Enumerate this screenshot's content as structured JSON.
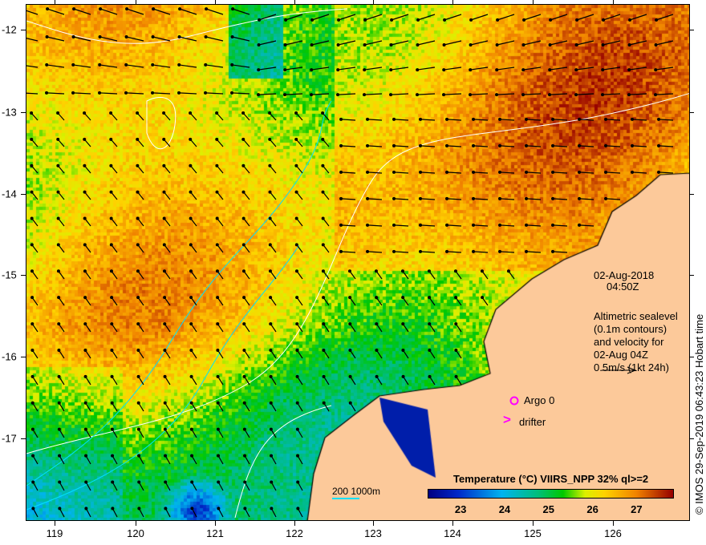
{
  "axes": {
    "lon_ticks": [
      "119",
      "120",
      "121",
      "122",
      "123",
      "124",
      "125",
      "126"
    ],
    "lat_ticks": [
      "-12",
      "-13",
      "-14",
      "-15",
      "-16",
      "-17"
    ]
  },
  "annotation": {
    "date": "02-Aug-2018",
    "time": "04:50Z",
    "sealevel_lines": [
      "Altimetric sealevel",
      "(0.1m contours)",
      "and velocity for",
      "02-Aug 04Z",
      "0.5m/s (1kt 24h)"
    ]
  },
  "legend": {
    "argo": "Argo 0",
    "drifter": "drifter",
    "drifter_symbol": ">",
    "bathy": "200  1000m"
  },
  "colorbar": {
    "title": "Temperature (°C) VIIRS_NPP 32% ql>=2",
    "ticks": [
      "23",
      "24",
      "25",
      "26",
      "27"
    ],
    "range": [
      22.25,
      27.85
    ]
  },
  "credit": "© IMOS 29-Sep-2019 06:43:23 Hobart time",
  "colors": {
    "land": "#fcc99a",
    "argo": "#ff00ff",
    "bathy": "#00e0ff"
  }
}
